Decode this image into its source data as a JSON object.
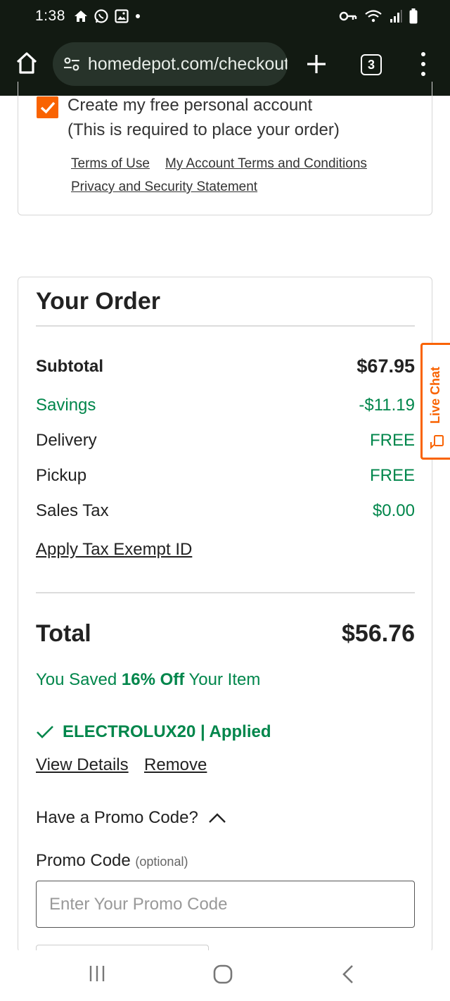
{
  "status_bar": {
    "time": "1:38"
  },
  "browser": {
    "url": "homedepot.com/checkout",
    "tab_count": "3"
  },
  "account": {
    "checkbox_checked": true,
    "line1": "Create my free personal account",
    "line2": "(This is required to place your order)",
    "links": {
      "terms": "Terms of Use",
      "account_terms": "My Account Terms and Conditions",
      "privacy": "Privacy and Security Statement"
    }
  },
  "order": {
    "title": "Your Order",
    "subtotal_label": "Subtotal",
    "subtotal_value": "$67.95",
    "savings_label": "Savings",
    "savings_value": "-$11.19",
    "delivery_label": "Delivery",
    "delivery_value": "FREE",
    "pickup_label": "Pickup",
    "pickup_value": "FREE",
    "tax_label": "Sales Tax",
    "tax_value": "$0.00",
    "tax_exempt_link": "Apply Tax Exempt ID",
    "total_label": "Total",
    "total_value": "$56.76",
    "saved_prefix": "You Saved ",
    "saved_percent": "16% Off",
    "saved_suffix": " Your Item",
    "promo_applied": "ELECTROLUX20 | Applied",
    "view_details": "View Details",
    "remove": "Remove",
    "promo_question": "Have a Promo Code?",
    "promo_label": "Promo Code",
    "promo_optional": "(optional)",
    "promo_placeholder": "Enter Your Promo Code"
  },
  "live_chat": {
    "label": "Live Chat"
  },
  "colors": {
    "accent": "#f96302",
    "success": "#00864b",
    "bar": "#121a12"
  }
}
